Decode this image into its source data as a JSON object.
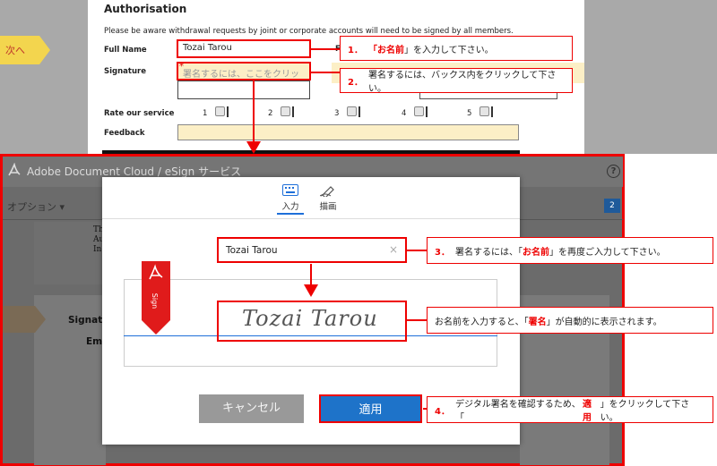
{
  "form": {
    "heading": "Authorisation",
    "notice": "Please be aware withdrawal requests by joint or corporate accounts will need to be signed by all members.",
    "next_tab": "次へ",
    "full_name_label": "Full Name",
    "full_name_value": "Tozai Tarou",
    "signature_label": "Signature",
    "signature_placeholder": "署名するには、ここをクリック",
    "required_mark": "*",
    "rate_label": "Rate our service",
    "rate_options": [
      "1",
      "2",
      "3",
      "4",
      "5"
    ],
    "feedback_label": "Feedback",
    "hidden_label_initial": "F"
  },
  "callouts": [
    {
      "num": "1．",
      "pre": "「",
      "bold": "お名前",
      "post": "」を入力して下さい。"
    },
    {
      "num": "2．",
      "pre": "署名するには、バックス内をクリックして下さい。",
      "bold": "",
      "post": ""
    },
    {
      "num": "3．",
      "pre": "署名するには、「",
      "bold": "お名前",
      "post": "」を再度ご入力して下さい。"
    },
    {
      "num": "",
      "pre": "お名前を入力すると、「",
      "bold": "署名",
      "post": "」が自動的に表示されます。"
    },
    {
      "num": "4．",
      "pre": "デジタル署名を確認するため、「",
      "bold": "適用",
      "post": "」をクリックして下さい。"
    }
  ],
  "esign": {
    "app_title": "Adobe Document Cloud / eSign サービス",
    "help": "?",
    "options_label": "オプション ▾",
    "page_badge": "2",
    "bg_text_lines": [
      "Th",
      "Au",
      "In"
    ],
    "bg_label_1": "Signatu",
    "bg_label_2": "Ema"
  },
  "dialog": {
    "tab_type": "入力",
    "tab_draw": "描画",
    "name_value": "Tozai Tarou",
    "clear_icon": "×",
    "sign_flag_text": "Sign",
    "signature_rendered": "Tozai Tarou",
    "cancel_label": "キャンセル",
    "apply_label": "適用"
  },
  "colors": {
    "accent_red": "#e00000",
    "apply_blue": "#1e73c9",
    "field_yellow": "#fcefc6"
  }
}
